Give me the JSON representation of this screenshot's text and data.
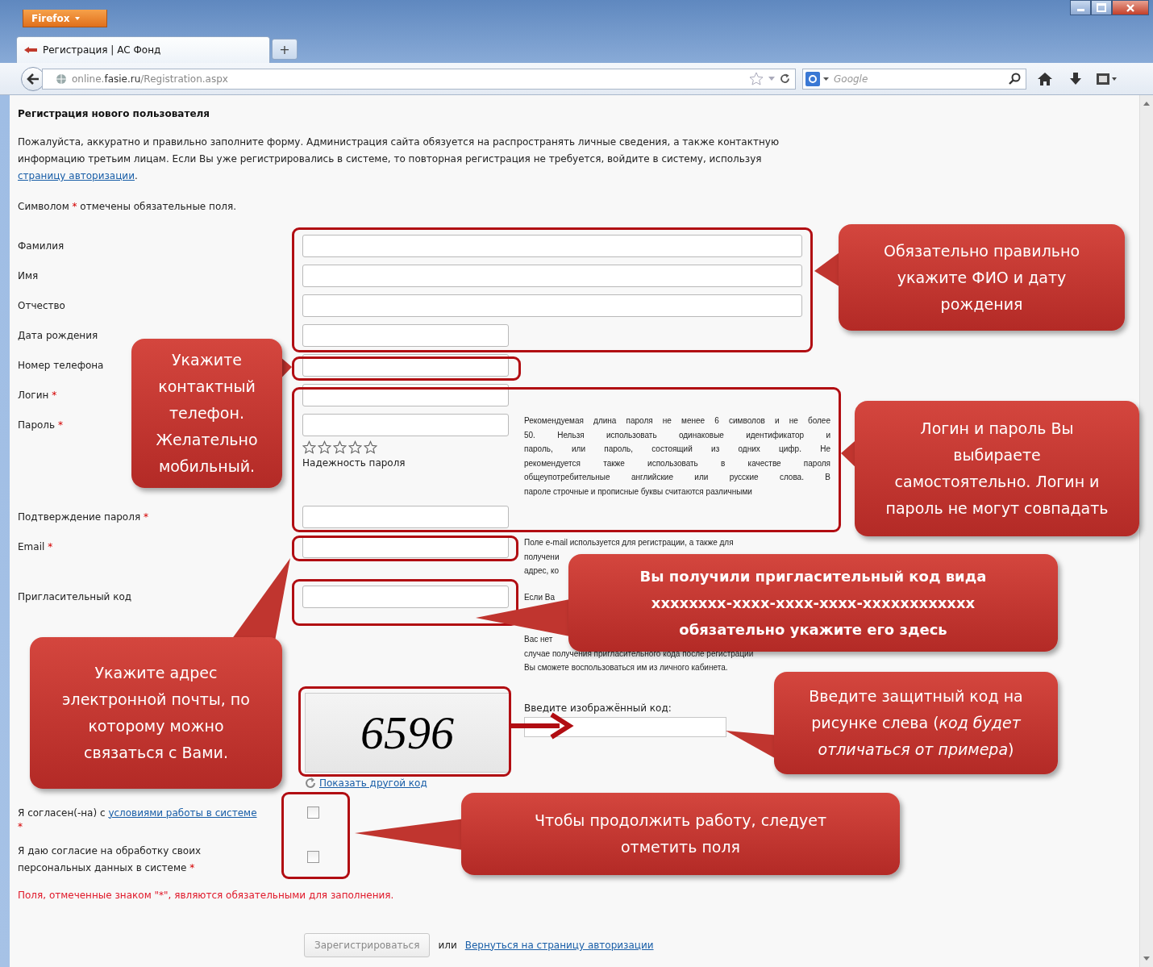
{
  "browser": {
    "menu_button": "Firefox",
    "tab": {
      "title": "Регистрация | АС Фонд"
    },
    "new_tab": "+",
    "address": {
      "prefix": "online.",
      "domain": "fasie.ru",
      "path": "/Registration.aspx"
    },
    "search": {
      "placeholder": "Google"
    }
  },
  "page": {
    "title": "Регистрация нового пользователя",
    "intro": {
      "text": "Пожалуйста, аккуратно и правильно заполните форму. Администрация сайта обязуется на распространять личные сведения, а также контактную информацию третьим лицам. Если Вы уже регистрировались в системе, то повторная регистрация не требуется, войдите в систему, используя ",
      "link": "страницу авторизации",
      "end": "."
    },
    "legend": {
      "before": "Символом ",
      "mark": "*",
      "after": " отмечены обязательные поля."
    }
  },
  "fields": [
    {
      "label": "Фамилия",
      "kind": "text",
      "wide": true
    },
    {
      "label": "Имя",
      "kind": "text",
      "wide": true
    },
    {
      "label": "Отчество",
      "kind": "text",
      "wide": true
    },
    {
      "label": "Дата рождения",
      "kind": "text",
      "wide": false
    },
    {
      "label": "Номер телефона",
      "kind": "text",
      "wide": false
    },
    {
      "label": "Логин",
      "required": "*",
      "kind": "text",
      "wide": false
    },
    {
      "label": "Пароль",
      "required": "*",
      "kind": "password",
      "wide": false,
      "strength": {
        "stars": 0,
        "label": "Надежность пароля"
      },
      "help": [
        "Рекомендуемая длина пароля не менее 6 символов и не более",
        "50. Нельзя использовать одинаковые идентификатор и",
        "пароль, или пароль, состоящий из одних цифр. Не",
        "рекомендуется также использовать в качестве пароля",
        "общеупотребительные английские или русские слова. В",
        "пароле строчные и прописные буквы считаются различными"
      ]
    },
    {
      "label": "Подтверждение пароля",
      "required": "*",
      "kind": "password",
      "wide": false
    },
    {
      "label": "Email",
      "required": "*",
      "kind": "text",
      "wide": false,
      "help": [
        "Поле e-mail используется для регистрации, а также для",
        "получени",
        "адрес, ко"
      ]
    },
    {
      "label": "Пригласительный код",
      "kind": "text",
      "wide": false,
      "help": [
        "Если Ва",
        "Вас нет",
        "случае получения пригласительного кода после регистрации",
        "Вы сможете воспользоваться им из личного кабинета."
      ]
    }
  ],
  "captcha": {
    "code": "6596",
    "prompt": "Введите изображённый код:",
    "refresh_link": "Показать другой код"
  },
  "agreements": [
    {
      "text": "Я согласен(-на) с ",
      "link": "условиями работы в системе",
      "required": "*",
      "checked": false
    },
    {
      "text": "Я даю согласие на обработку своих персональных данных в системе",
      "required": "*",
      "checked": false
    }
  ],
  "required_note": "Поля, отмеченные знаком \"*\", являются обязательными для заполнения.",
  "submit": {
    "label": "Зарегистрироваться",
    "disabled": true
  },
  "or_text": "или",
  "back_link": "Вернуться на страницу авторизации",
  "callouts": [
    {
      "lines": [
        "Обязательно правильно",
        "укажите ФИО и дату",
        "рождения"
      ],
      "bold": false
    },
    {
      "lines": [
        "Укажите",
        "контактный",
        "телефон.",
        "Желательно",
        "мобильный."
      ],
      "bold": false
    },
    {
      "lines": [
        "Логин и пароль Вы",
        "выбираете",
        "самостоятельно. Логин и",
        "пароль не могут совпадать"
      ],
      "bold": false
    },
    {
      "lines": [
        "Вы получили пригласительный код вида",
        "xxxxxxxx-xxxx-xxxx-xxxx-xxxxxxxxxxxx",
        "обязательно укажите его здесь"
      ],
      "bold": true
    },
    {
      "lines": [
        "Укажите адрес",
        "электронной почты, по",
        "которому можно",
        "связаться с Вами."
      ],
      "bold": false
    },
    {
      "lines": [
        "Введите защитный код на",
        "рисунке слева (*код будет*",
        "*отличаться от примера*)"
      ],
      "bold": false
    },
    {
      "lines": [
        "Чтобы продолжить работу, следует",
        "отметить поля"
      ],
      "bold": false
    }
  ]
}
